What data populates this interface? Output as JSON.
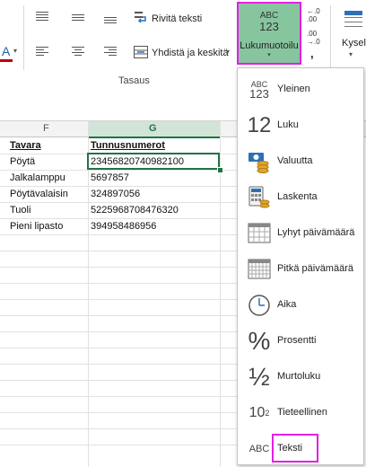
{
  "ribbon": {
    "wrap_text": "Rivitä teksti",
    "merge_center": "Yhdistä ja keskitä",
    "alignment_group": "Tasaus",
    "number_format_icon_top": "ABC",
    "number_format_icon_bottom": "123",
    "number_format": "Lukumuotoilu",
    "queries_partial": "Kysel",
    "font_partial": "A",
    "increase_decimal_top": "←.0",
    "increase_decimal_bottom": ".00",
    "decrease_decimal_top": ".00",
    "decrease_decimal_bottom": "→.0",
    "comma": ","
  },
  "sheet": {
    "columns": [
      "F",
      "G"
    ],
    "header": [
      "Tavara",
      "Tunnusnumerot"
    ],
    "rows": [
      [
        "Pöytä",
        "23456820740982100"
      ],
      [
        "Jalkalamppu",
        "5697857"
      ],
      [
        "Pöytävalaisin",
        "324897056"
      ],
      [
        "Tuoli",
        "5225968708476320"
      ],
      [
        "Pieni lipasto",
        "394958486956"
      ]
    ]
  },
  "menu": {
    "items": [
      {
        "label": "Yleinen",
        "icon": "abc-123-icon",
        "glyph_top": "ABC",
        "glyph_bottom": "123"
      },
      {
        "label": "Luku",
        "icon": "number-12-icon",
        "glyph": "12"
      },
      {
        "label": "Valuutta",
        "icon": "currency-icon"
      },
      {
        "label": "Laskenta",
        "icon": "calculator-icon"
      },
      {
        "label": "Lyhyt päivämäärä",
        "icon": "calendar-icon"
      },
      {
        "label": "Pitkä päivämäärä",
        "icon": "calendar-icon"
      },
      {
        "label": "Aika",
        "icon": "clock-icon"
      },
      {
        "label": "Prosentti",
        "icon": "percent-icon",
        "glyph": "%"
      },
      {
        "label": "Murtoluku",
        "icon": "fraction-icon",
        "glyph": "½"
      },
      {
        "label": "Tieteellinen",
        "icon": "scientific-icon",
        "glyph": "10",
        "glyph_sup": "2"
      },
      {
        "label": "Teksti",
        "icon": "text-abc-icon",
        "glyph": "ABC"
      }
    ]
  },
  "colors": {
    "selected_button_bg": "#87c59f",
    "highlight_border": "#e41fe4",
    "selected_cell_border": "#217346",
    "active_col_header_bg": "#d2e4d8"
  }
}
